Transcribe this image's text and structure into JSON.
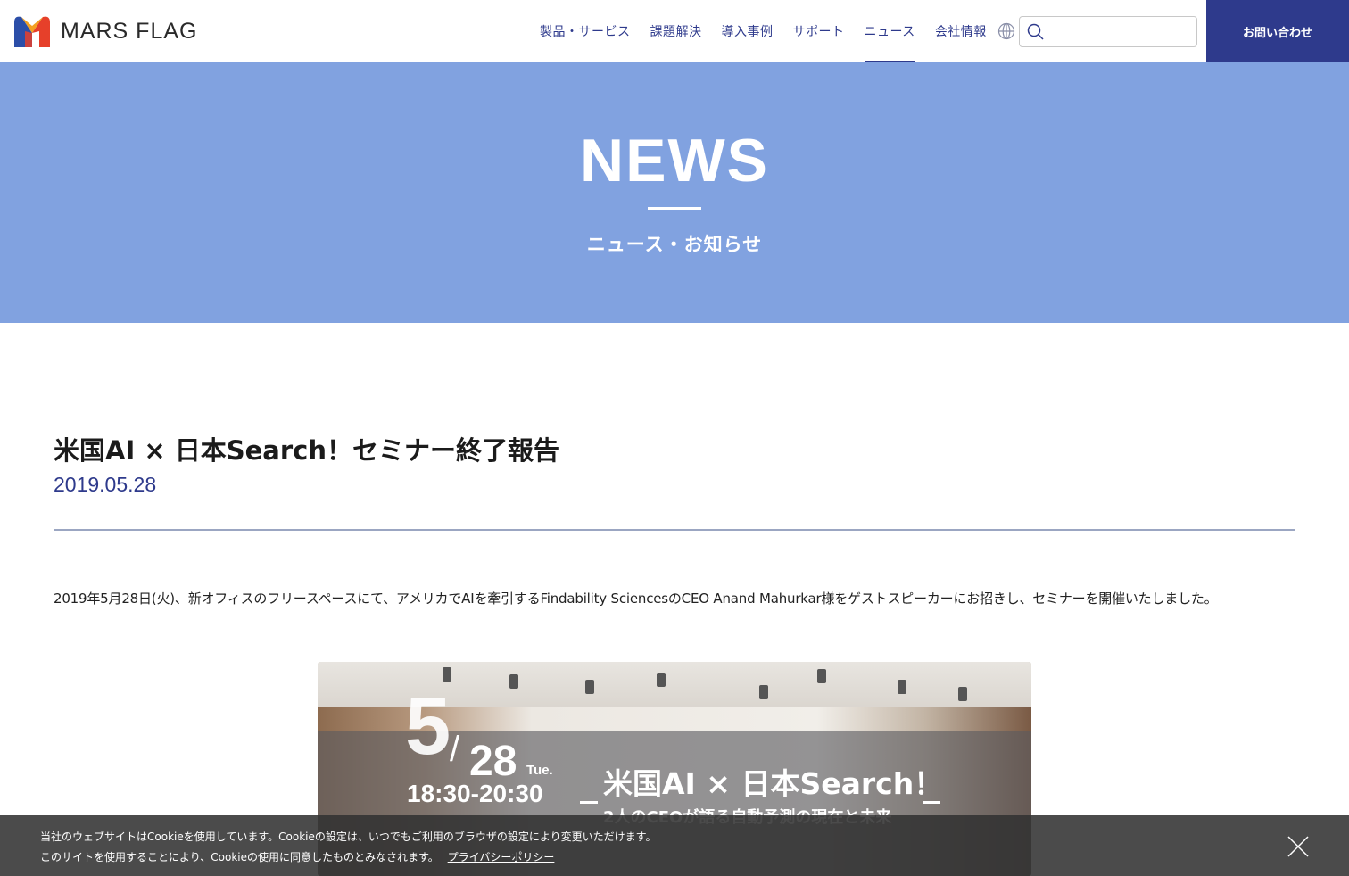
{
  "header": {
    "logo_text": "MARS FLAG",
    "nav": [
      {
        "label": "製品・サービス"
      },
      {
        "label": "課題解決"
      },
      {
        "label": "導入事例"
      },
      {
        "label": "サポート"
      },
      {
        "label": "ニュース",
        "active": true
      },
      {
        "label": "会社情報"
      }
    ],
    "search_placeholder": "",
    "contact_label": "お問い合わせ"
  },
  "hero": {
    "title": "NEWS",
    "subtitle": "ニュース・お知らせ"
  },
  "article": {
    "title": "米国AI × 日本Search！セミナー終了報告",
    "date": "2019.05.28",
    "body": "2019年5月28日(火)、新オフィスのフリースペースにて、アメリカでAIを牽引するFindability SciencesのCEO Anand Mahurkar様をゲストスピーカーにお招きし、セミナーを開催いたしました。"
  },
  "banner": {
    "month": "5",
    "slash": "/",
    "day": "28",
    "weekday": "Tue.",
    "time": "18:30-20:30",
    "title": "米国AI × 日本Search！",
    "subtitle": "2人のCEOが語る自動予測の現在と未来"
  },
  "cookie": {
    "line1": "当社のウェブサイトはCookieを使用しています。Cookieの設定は、いつでもご利用のブラウザの設定により変更いただけます。",
    "line2": "このサイトを使用することにより、Cookieの使用に同意したものとみなされます。",
    "link": "プライバシーポリシー"
  },
  "colors": {
    "brand_navy": "#2e3a8c",
    "hero_bg": "#81a2e0",
    "logo_red": "#e6402a",
    "logo_orange": "#f4a020",
    "logo_blue": "#2b4ea8"
  }
}
